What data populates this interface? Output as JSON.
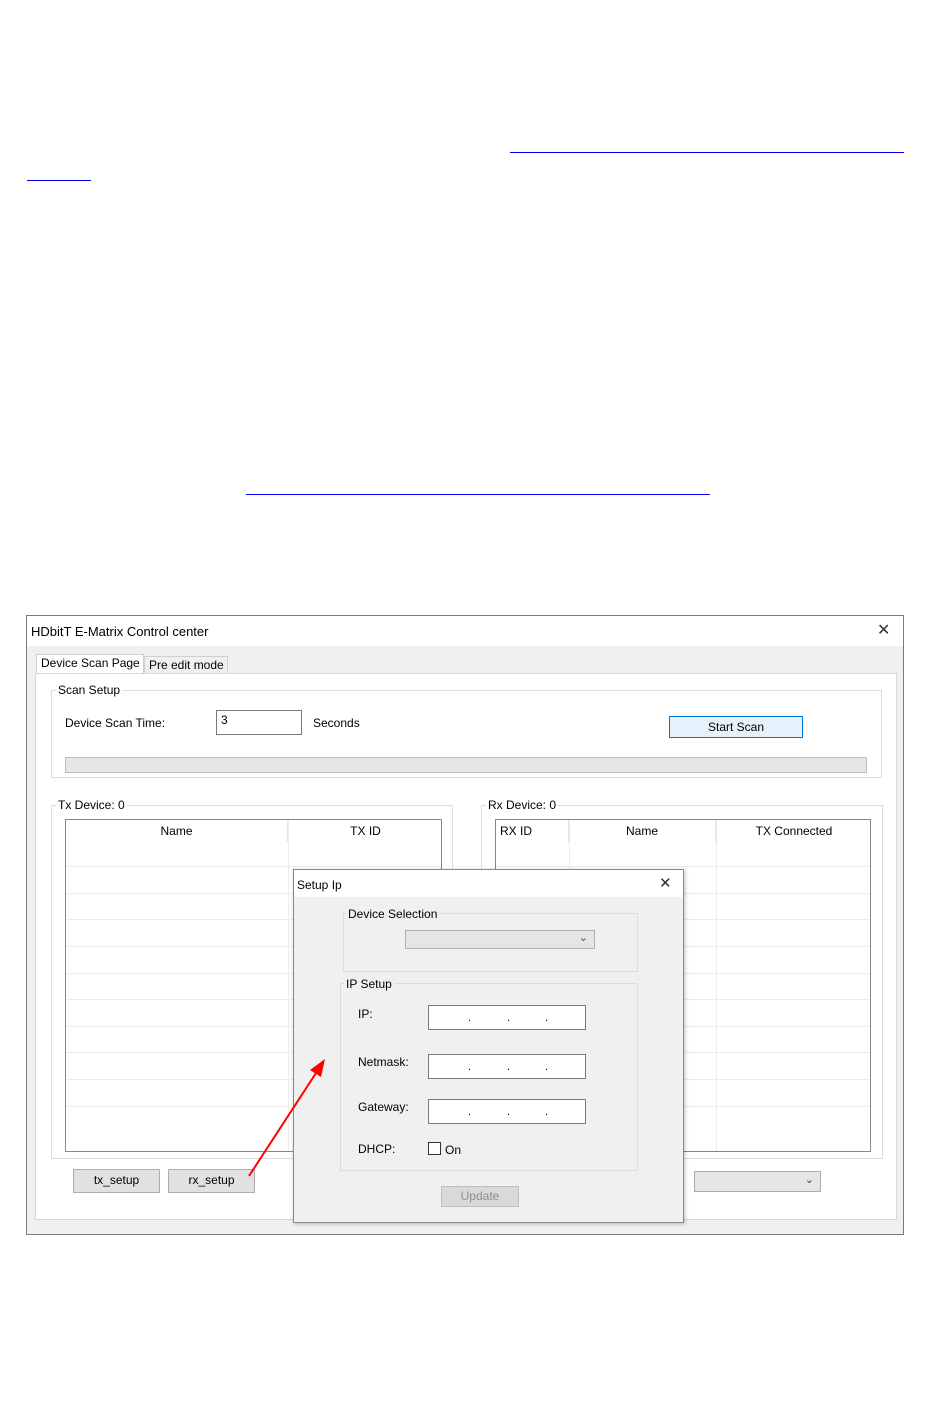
{
  "app": {
    "title": "HDbitT E-Matrix Control center",
    "tabs": [
      {
        "label": "Device Scan Page",
        "active": true
      },
      {
        "label": "Pre edit mode",
        "active": false
      }
    ]
  },
  "scan_setup": {
    "legend": "Scan Setup",
    "time_label": "Device Scan Time:",
    "time_value": "3",
    "unit": "Seconds",
    "start_button": "Start Scan",
    "progress": 0
  },
  "tx_panel": {
    "legend": "Tx Device: 0",
    "columns": [
      "Name",
      "TX ID"
    ],
    "setup_buttons": [
      "tx_setup",
      "rx_setup"
    ]
  },
  "rx_panel": {
    "legend": "Rx Device: 0",
    "columns": [
      "RX ID",
      "Name",
      "TX Connected"
    ]
  },
  "setup_ip_dialog": {
    "title": "Setup Ip",
    "device_selection_legend": "Device Selection",
    "device_selection_value": "",
    "ip_setup_legend": "IP Setup",
    "fields": [
      {
        "label": "IP:",
        "value": ". . ."
      },
      {
        "label": "Netmask:",
        "value": ". . ."
      },
      {
        "label": "Gateway:",
        "value": ". . ."
      }
    ],
    "dhcp_label": "DHCP:",
    "dhcp_option": "On",
    "dhcp_checked": false,
    "update_button": "Update"
  },
  "annotation": {
    "arrow_color": "#ff0000"
  },
  "colors": {
    "link": "#0000ee",
    "accent": "#0078d7"
  }
}
